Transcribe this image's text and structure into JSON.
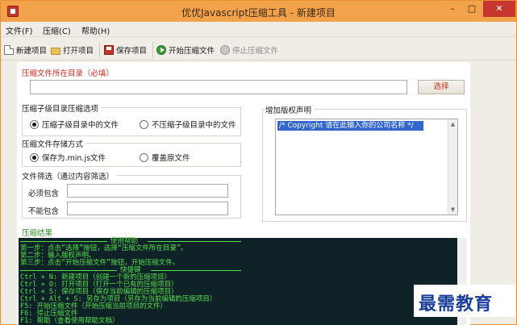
{
  "window": {
    "title": "优优Javascript压缩工具 - 新建项目",
    "controls": {
      "minimize": "–",
      "maximize": "□",
      "close": "✕"
    }
  },
  "menu": [
    {
      "label": "文件(F)"
    },
    {
      "label": "压缩(C)"
    },
    {
      "label": "帮助(H)"
    }
  ],
  "toolbar": {
    "new_project": "新建项目",
    "open_project": "打开项目",
    "save_project": "保存项目",
    "start_compress": "开始压缩文件",
    "stop_compress": "停止压缩文件"
  },
  "directory": {
    "label": "压缩文件所在目录（必填）",
    "value": "",
    "browse": "选择"
  },
  "subdir_options": {
    "label": "压缩子级目录压缩选项",
    "options": [
      {
        "label": "压缩子级目录中的文件",
        "selected": true
      },
      {
        "label": "不压缩子级目录中的文件",
        "selected": false
      }
    ]
  },
  "storage": {
    "label": "压缩文件存储方式",
    "options": [
      {
        "label": "保存为.min.js文件",
        "selected": true
      },
      {
        "label": "覆盖原文件",
        "selected": false
      }
    ]
  },
  "filter": {
    "label": "文件筛选（通过内容筛选）",
    "must_contain_label": "必须包含",
    "must_contain_value": "",
    "must_not_contain_label": "不能包含",
    "must_not_contain_value": ""
  },
  "copyright": {
    "label": "增加版权声明",
    "value": "/* Copyright 请在此输入你的公司名称 */"
  },
  "result": {
    "label": "压缩结果",
    "lines": [
      "使用帮助",
      "第一步：点击“选择”按钮，选择“压缩文件所在目录”。",
      "第二步：输入版权声明。",
      "第三步：点击“开始压缩文件”按钮，开始压缩文件。",
      "快捷键",
      "Ctrl + N: 新建项目（创建一个新的压缩项目）",
      "Ctrl + O: 打开项目（打开一个已有的压缩项目）",
      "Ctrl + S: 保存项目（保存当前编辑的压缩项目）",
      "Ctrl + Alt + S: 另存为项目（另存为当前编辑的压缩项目）",
      "F5: 开始压缩文件（开始压缩当前项目的文件）",
      "F6: 停止压缩文件",
      "F1: 帮助（查看使用帮助文档）"
    ]
  },
  "watermark": "最需教育",
  "colors": {
    "title_bar": "#f2a24a",
    "close_button": "#c7362e",
    "required_label": "#cf2b1e",
    "result_background": "#0e2228",
    "result_text": "#52e04a",
    "selection": "#3366cc",
    "watermark": "#1a3f9a"
  }
}
